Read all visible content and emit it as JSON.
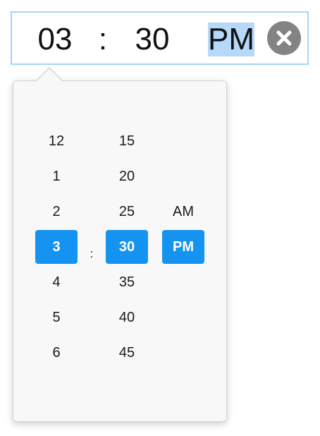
{
  "time_input": {
    "hour": "03",
    "separator": ":",
    "minute": "30",
    "meridiem": "PM",
    "meridiem_highlight_color": "#b6d8fb",
    "clear_icon": "close-circle-icon"
  },
  "picker": {
    "hours": [
      "12",
      "1",
      "2",
      "3",
      "4",
      "5",
      "6"
    ],
    "selected_hour": "3",
    "separator": ":",
    "minutes": [
      "15",
      "20",
      "25",
      "30",
      "35",
      "40",
      "45"
    ],
    "selected_minute": "30",
    "meridiem": [
      "AM",
      "PM"
    ],
    "selected_meridiem": "PM",
    "accent_color": "#1593f0"
  }
}
